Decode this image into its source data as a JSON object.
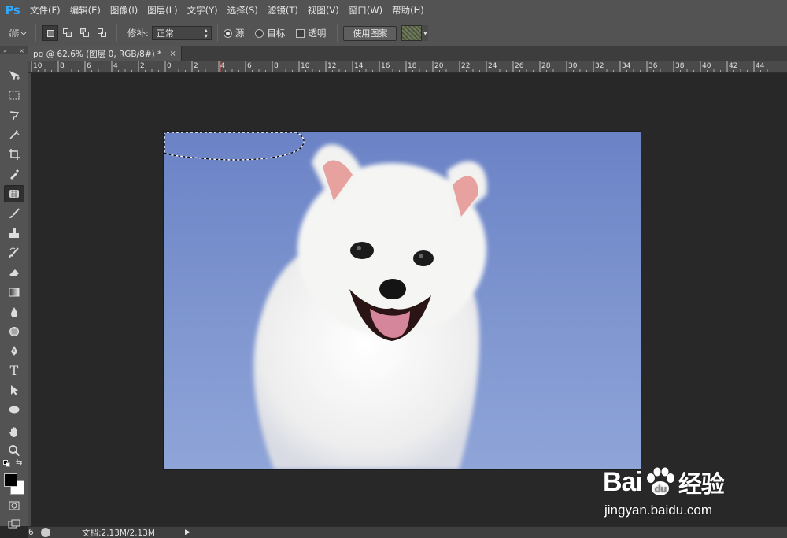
{
  "app": {
    "logo": "Ps",
    "accent_color": "#31a8ff"
  },
  "menu": {
    "items": [
      "文件(F)",
      "编辑(E)",
      "图像(I)",
      "图层(L)",
      "文字(Y)",
      "选择(S)",
      "滤镜(T)",
      "视图(V)",
      "窗口(W)",
      "帮助(H)"
    ]
  },
  "options_bar": {
    "patch_label": "修补:",
    "patch_value": "正常",
    "source_label": "源",
    "source_checked": true,
    "target_label": "目标",
    "target_checked": false,
    "transparent_label": "透明",
    "transparent_checked": false,
    "use_pattern_button": "使用图案"
  },
  "document": {
    "tab_title": "pg @ 62.6% (图层 0, RGB/8#) *",
    "close_glyph": "×",
    "status_text": "文档:2.13M/2.13M",
    "left_status": "6"
  },
  "ruler": {
    "labels": [
      "10",
      "8",
      "6",
      "4",
      "2",
      "0",
      "2",
      "4",
      "6",
      "8",
      "10",
      "12",
      "14",
      "16",
      "18",
      "20",
      "22",
      "24",
      "26",
      "28",
      "30",
      "32",
      "34",
      "36",
      "38",
      "40",
      "42",
      "44"
    ]
  },
  "toolbar": {
    "tools": [
      "move-icon",
      "marquee-icon",
      "lasso-icon",
      "quick-select-icon",
      "crop-icon",
      "eyedropper-icon",
      "patch-tool-icon",
      "brush-icon",
      "stamp-icon",
      "history-brush-icon",
      "eraser-icon",
      "gradient-icon",
      "blur-icon",
      "dodge-icon",
      "pen-icon",
      "text-icon",
      "path-select-icon",
      "ellipse-icon",
      "hand-icon",
      "zoom-icon"
    ],
    "active_tool": "patch-tool-icon",
    "foreground_color": "#000000",
    "background_color": "#ffffff"
  },
  "watermark": {
    "brand_text": "Bai",
    "brand_suffix": "经验",
    "url": "jingyan.baidu.com"
  },
  "canvas": {
    "sky_color": "#7189c9",
    "dog_color": "#f4f4f2"
  }
}
